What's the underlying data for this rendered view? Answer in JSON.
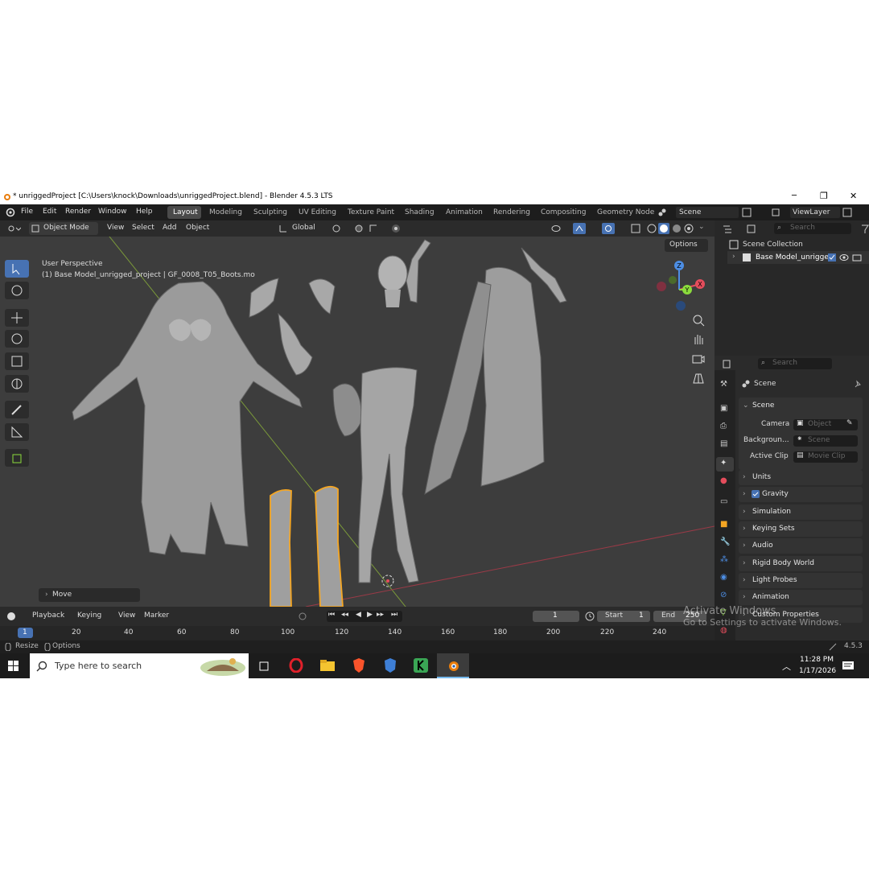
{
  "titlebar": {
    "title": "* unriggedProject [C:\\Users\\knock\\Downloads\\unriggedProject.blend] - Blender 4.5.3 LTS",
    "minimize": "─",
    "restore": "❐",
    "close": "✕"
  },
  "menu": [
    "File",
    "Edit",
    "Render",
    "Window",
    "Help"
  ],
  "workspaces": [
    "Layout",
    "Modeling",
    "Sculpting",
    "UV Editing",
    "Texture Paint",
    "Shading",
    "Animation",
    "Rendering",
    "Compositing",
    "Geometry Node"
  ],
  "scene_name": "Scene",
  "view_layer": "ViewLayer",
  "header3d": {
    "mode": "Object Mode",
    "menus": [
      "View",
      "Select",
      "Add",
      "Object"
    ],
    "orientation": "Global",
    "options": "Options"
  },
  "viewport": {
    "view_label": "User Perspective",
    "object_label": "(1) Base Model_unrigged_project | GF_0008_T05_Boots.mo",
    "last_op": "Move",
    "gizmo_axes": [
      "X",
      "Y",
      "Z"
    ]
  },
  "timeline": {
    "menus": [
      "Playback",
      "Keying",
      "View",
      "Marker"
    ],
    "current_frame": "1",
    "start_label": "Start",
    "start": "1",
    "end_label": "End",
    "end": "250",
    "ruler": [
      "1",
      "20",
      "40",
      "60",
      "80",
      "100",
      "120",
      "140",
      "160",
      "180",
      "200",
      "220",
      "240"
    ]
  },
  "status": {
    "left": "Resize",
    "mid": "Options",
    "version": "4.5.3"
  },
  "outliner": {
    "search": "Search",
    "collection": "Scene Collection",
    "item": "Base Model_unrigge"
  },
  "properties": {
    "search": "Search",
    "context": "Scene",
    "panel": "Scene",
    "camera_label": "Camera",
    "camera_ph": "Object",
    "background_label": "Backgroun...",
    "background_ph": "Scene",
    "clip_label": "Active Clip",
    "clip_ph": "Movie Clip",
    "sections": [
      "Units",
      "Gravity",
      "Simulation",
      "Keying Sets",
      "Audio",
      "Rigid Body World",
      "Light Probes",
      "Animation",
      "Custom Properties"
    ]
  },
  "watermark": {
    "line1": "Activate Windows",
    "line2": "Go to Settings to activate Windows."
  },
  "taskbar": {
    "search_placeholder": "Type here to search",
    "time": "11:28 PM",
    "date": "1/17/2026"
  },
  "colors": {
    "accent": "#4772b3",
    "selection": "#f5a623",
    "x_axis": "#e44d5c",
    "y_axis": "#8bdb3c",
    "z_axis": "#4d8ee4"
  }
}
